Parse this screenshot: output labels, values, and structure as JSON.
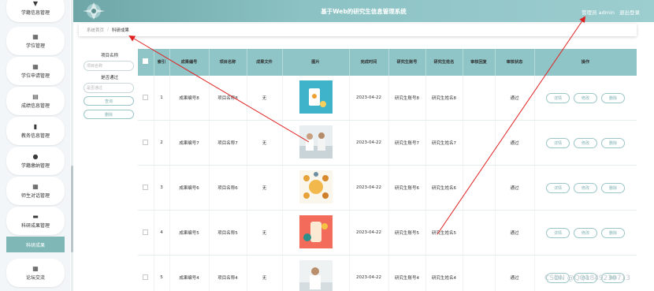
{
  "header": {
    "title": "基于Web的研究生信息管理系统",
    "user": "管理员 admin",
    "logout": "退出登录"
  },
  "breadcrumb": {
    "home": "系统首页",
    "sep": "/",
    "current": "科研成果"
  },
  "sidebar": {
    "items": [
      {
        "label": "学籍信息管理",
        "icon": "pin-icon"
      },
      {
        "label": "学位管理",
        "icon": "grid-icon"
      },
      {
        "label": "学位申请管理",
        "icon": "grid-icon"
      },
      {
        "label": "成绩信息管理",
        "icon": "table-icon"
      },
      {
        "label": "教务信息管理",
        "icon": "bar-chart-icon"
      },
      {
        "label": "学籍缴纳管理",
        "icon": "user-icon"
      },
      {
        "label": "师生对话管理",
        "icon": "grid-icon"
      },
      {
        "label": "科研成果管理",
        "icon": "monitor-icon"
      },
      {
        "label": "论坛交流",
        "icon": "grid-icon"
      }
    ],
    "sub_active": "科研成果"
  },
  "filter": {
    "name_label": "项目名称",
    "name_placeholder": "项目名称",
    "pass_label": "是否通过",
    "pass_placeholder": "是否通过",
    "search_btn": "查询",
    "delete_btn": "删除"
  },
  "table": {
    "headers": [
      "索引",
      "成果编号",
      "项目名称",
      "成果文件",
      "图片",
      "完成时间",
      "研究生账号",
      "研究生姓名",
      "审核回复",
      "审核状态",
      "操作"
    ],
    "rows": [
      {
        "index": "1",
        "code": "成果编号8",
        "project": "项目名称8",
        "file": "无",
        "date": "2023-04-22",
        "account": "研究生账号8",
        "name": "研究生姓名8",
        "reply": "",
        "status": "通过"
      },
      {
        "index": "2",
        "code": "成果编号7",
        "project": "项目名称7",
        "file": "无",
        "date": "2023-04-22",
        "account": "研究生账号7",
        "name": "研究生姓名7",
        "reply": "",
        "status": "通过"
      },
      {
        "index": "3",
        "code": "成果编号6",
        "project": "项目名称6",
        "file": "无",
        "date": "2023-04-22",
        "account": "研究生账号6",
        "name": "研究生姓名6",
        "reply": "",
        "status": "通过"
      },
      {
        "index": "4",
        "code": "成果编号5",
        "project": "项目名称5",
        "file": "无",
        "date": "2023-04-22",
        "account": "研究生账号5",
        "name": "研究生姓名5",
        "reply": "",
        "status": "通过"
      },
      {
        "index": "5",
        "code": "成果编号4",
        "project": "项目名称4",
        "file": "无",
        "date": "2023-04-22",
        "account": "研究生账号4",
        "name": "研究生姓名4",
        "reply": "",
        "status": "通过"
      }
    ],
    "ops": {
      "detail": "详情",
      "edit": "修改",
      "delete": "删除"
    }
  },
  "watermark": "CSDN @QQ1849230713",
  "colors": {
    "accent": "#8fc5c7",
    "header": "#7fb6b8",
    "annotation": "#e02020"
  }
}
